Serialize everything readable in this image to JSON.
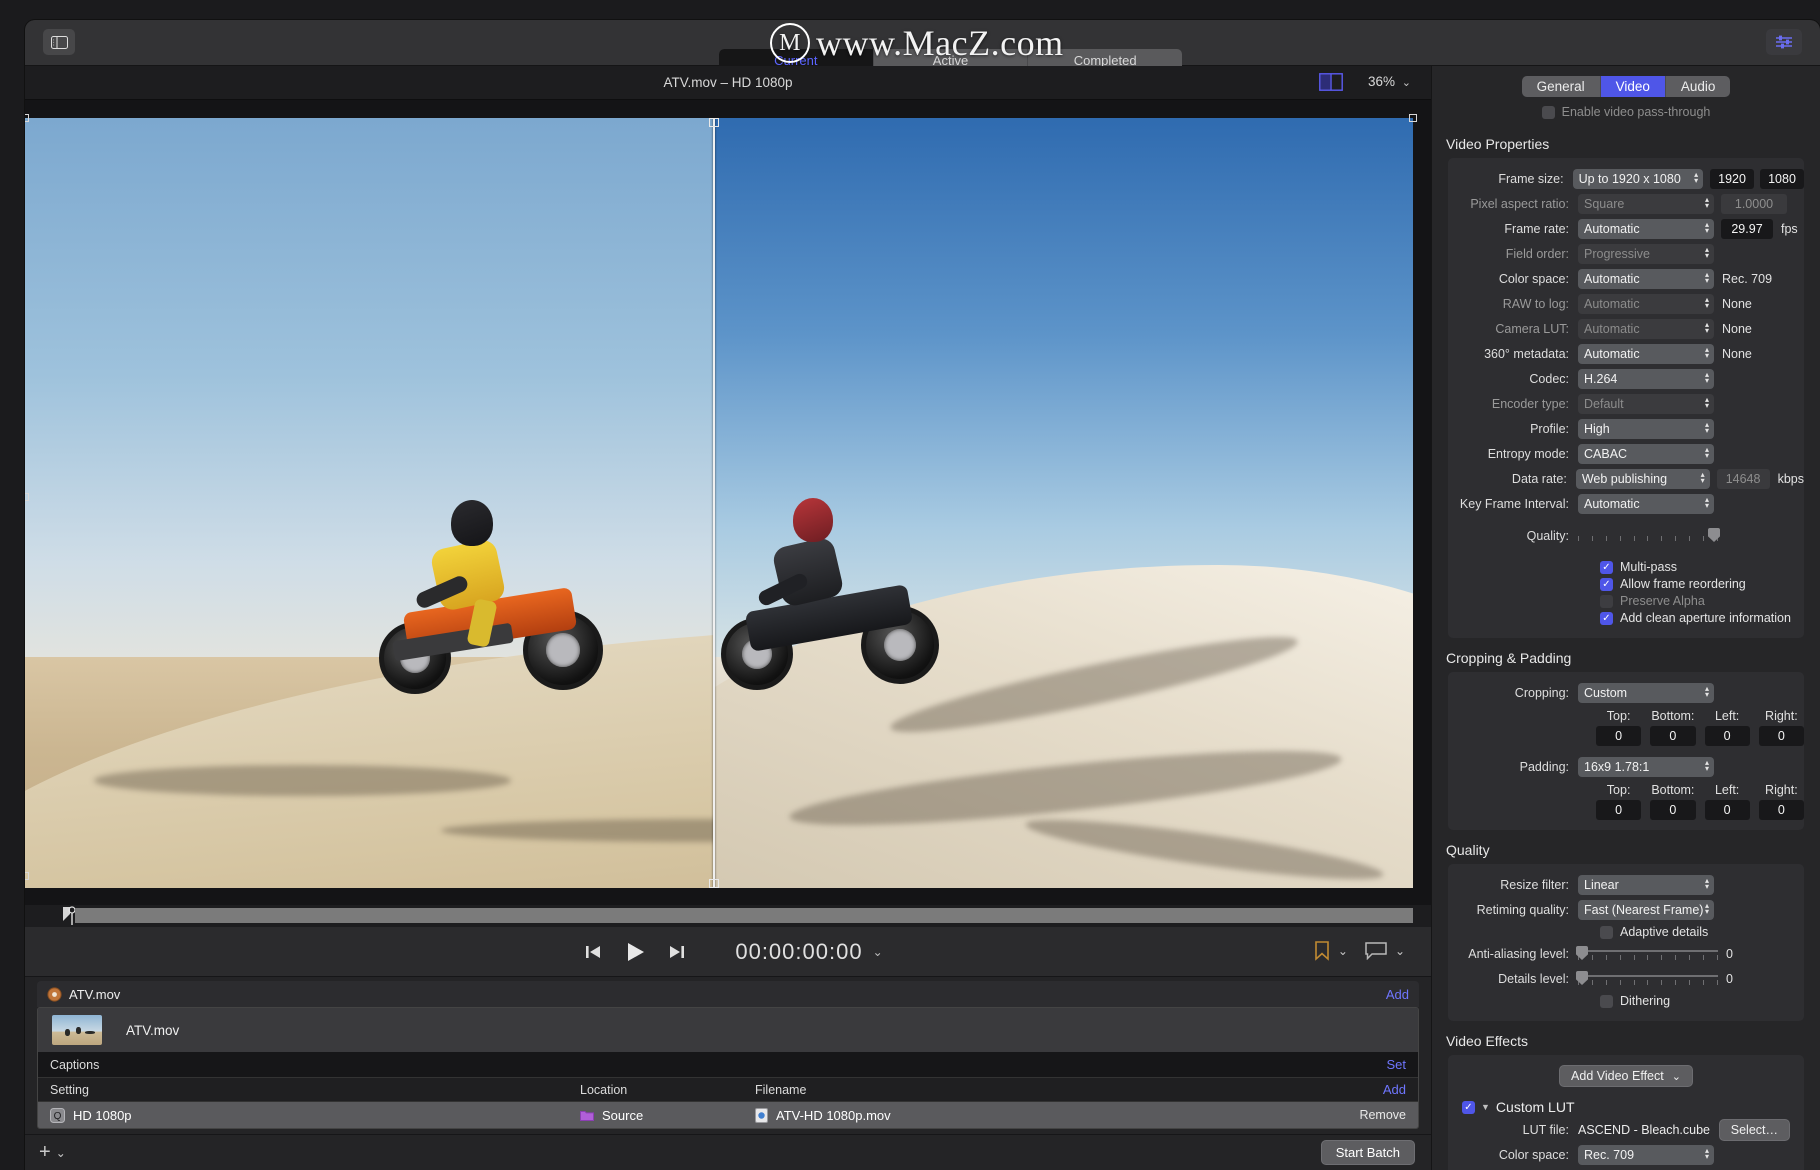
{
  "toolbar": {
    "sidebar_toggle": "sidebar-toggle",
    "inspector_toggle": "inspector-toggle",
    "segments": [
      {
        "label": "Current",
        "active": true
      },
      {
        "label": "Active",
        "active": false
      },
      {
        "label": "Completed",
        "active": false
      }
    ],
    "watermark": "www.MacZ.com",
    "watermark_mark": "M"
  },
  "preview": {
    "title": "ATV.mov – HD 1080p",
    "zoom": "36%",
    "split_view_icon": "split-view-icon",
    "chevron": "⌄"
  },
  "transport": {
    "timecode": "00:00:00:00",
    "prev_label": "skip-to-start",
    "play_label": "play",
    "next_label": "skip-to-end",
    "bookmark_icon": "bookmark-icon",
    "comment_icon": "comment-icon"
  },
  "batch": {
    "header_title": "ATV.mov",
    "header_action": "Add",
    "job_name": "ATV.mov",
    "captions_label": "Captions",
    "captions_action": "Set",
    "columns": {
      "setting": "Setting",
      "location": "Location",
      "filename": "Filename",
      "action": "Add"
    },
    "rows": [
      {
        "setting": "HD 1080p",
        "location": "Source",
        "filename": "ATV-HD 1080p.mov",
        "action": "Remove"
      }
    ],
    "add_button": "+",
    "add_chevron": "⌄",
    "start_batch": "Start Batch"
  },
  "inspector": {
    "tabs": [
      {
        "label": "General",
        "active": false
      },
      {
        "label": "Video",
        "active": true
      },
      {
        "label": "Audio",
        "active": false
      }
    ],
    "pass_through": {
      "label": "Enable video pass-through",
      "checked": false
    },
    "video_properties": {
      "title": "Video Properties",
      "fields": [
        {
          "label": "Frame size:",
          "value": "Up to 1920 x 1080",
          "disabled": false,
          "field1": "1920",
          "field2": "1080"
        },
        {
          "label": "Pixel aspect ratio:",
          "value": "Square",
          "disabled": true,
          "field1": "1.0000"
        },
        {
          "label": "Frame rate:",
          "value": "Automatic",
          "disabled": false,
          "field1": "29.97",
          "unit": "fps"
        },
        {
          "label": "Field order:",
          "value": "Progressive",
          "disabled": true
        },
        {
          "label": "Color space:",
          "value": "Automatic",
          "disabled": false,
          "static": "Rec. 709"
        },
        {
          "label": "RAW to log:",
          "value": "Automatic",
          "disabled": true,
          "static": "None"
        },
        {
          "label": "Camera LUT:",
          "value": "Automatic",
          "disabled": true,
          "static": "None"
        },
        {
          "label": "360° metadata:",
          "value": "Automatic",
          "disabled": false,
          "static": "None"
        },
        {
          "label": "Codec:",
          "value": "H.264",
          "disabled": false
        },
        {
          "label": "Encoder type:",
          "value": "Default",
          "disabled": true
        },
        {
          "label": "Profile:",
          "value": "High",
          "disabled": false
        },
        {
          "label": "Entropy mode:",
          "value": "CABAC",
          "disabled": false
        },
        {
          "label": "Data rate:",
          "value": "Web publishing",
          "disabled": false,
          "field1": "14648",
          "field1_disabled": true,
          "unit": "kbps"
        },
        {
          "label": "Key Frame Interval:",
          "value": "Automatic",
          "disabled": false
        }
      ],
      "quality_label": "Quality:",
      "quality_value": 100,
      "checkboxes": [
        {
          "label": "Multi-pass",
          "checked": true,
          "disabled": false
        },
        {
          "label": "Allow frame reordering",
          "checked": true,
          "disabled": false
        },
        {
          "label": "Preserve Alpha",
          "checked": false,
          "disabled": true
        },
        {
          "label": "Add clean aperture information",
          "checked": true,
          "disabled": false
        }
      ]
    },
    "cropping_padding": {
      "title": "Cropping & Padding",
      "cropping_label": "Cropping:",
      "cropping_value": "Custom",
      "padding_label": "Padding:",
      "padding_value": "16x9 1.78:1",
      "edge_labels": [
        "Top:",
        "Bottom:",
        "Left:",
        "Right:"
      ],
      "cropping_values": [
        "0",
        "0",
        "0",
        "0"
      ],
      "padding_values": [
        "0",
        "0",
        "0",
        "0"
      ]
    },
    "quality": {
      "title": "Quality",
      "resize_filter_label": "Resize filter:",
      "resize_filter_value": "Linear",
      "retiming_label": "Retiming quality:",
      "retiming_value": "Fast (Nearest Frame)",
      "adaptive_details": {
        "label": "Adaptive details",
        "checked": false
      },
      "anti_aliasing_label": "Anti-aliasing level:",
      "anti_aliasing_value": "0",
      "details_level_label": "Details level:",
      "details_level_value": "0",
      "dithering": {
        "label": "Dithering",
        "checked": false
      }
    },
    "video_effects": {
      "title": "Video Effects",
      "add_effect": "Add Video Effect",
      "add_effect_chevron": "⌄",
      "custom_lut": {
        "enabled": true,
        "disclosure": "▼",
        "name": "Custom LUT",
        "lut_file_label": "LUT file:",
        "lut_file_value": "ASCEND - Bleach.cube",
        "select_button": "Select…",
        "color_space_label": "Color space:",
        "color_space_value": "Rec. 709"
      }
    }
  },
  "colors": {
    "accent": "#4f56e8",
    "link": "#6f76ff",
    "panel": "#262628",
    "field": "#18181a"
  }
}
